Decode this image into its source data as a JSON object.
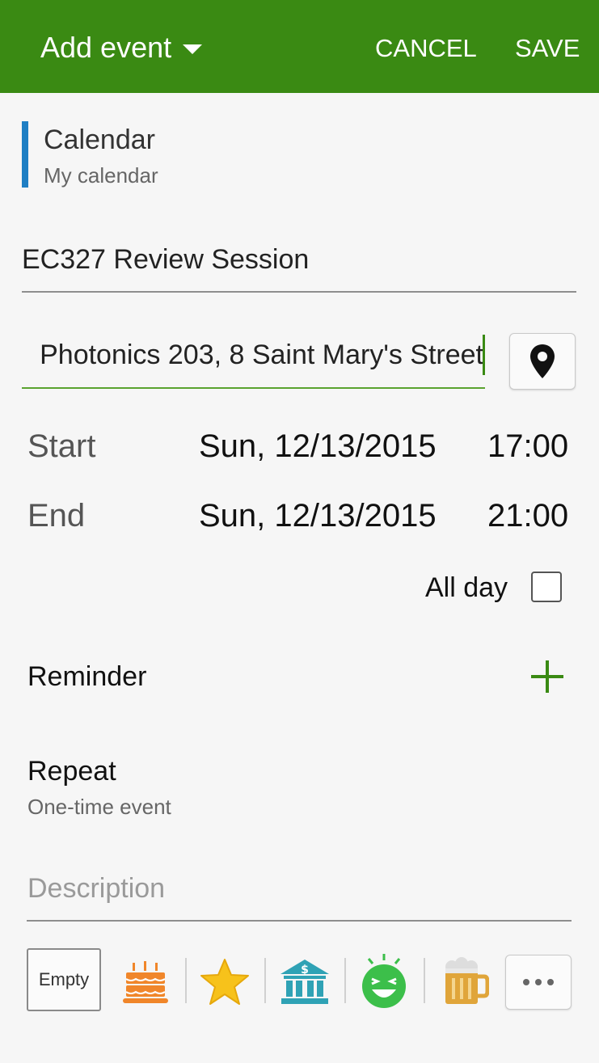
{
  "appbar": {
    "title": "Add event",
    "cancel_label": "CANCEL",
    "save_label": "SAVE",
    "color": "#3a8a13"
  },
  "calendar": {
    "label": "Calendar",
    "value": "My calendar",
    "accent_color": "#1f7fc4"
  },
  "event": {
    "title_value": "EC327 Review Session",
    "location_value": "Photonics 203, 8 Saint Mary's Street",
    "location_icon": "map-pin-icon"
  },
  "times": {
    "start_label": "Start",
    "start_date": "Sun, 12/13/2015",
    "start_time": "17:00",
    "end_label": "End",
    "end_date": "Sun, 12/13/2015",
    "end_time": "21:00",
    "all_day_label": "All day",
    "all_day_checked": false
  },
  "reminder": {
    "label": "Reminder",
    "add_icon": "plus-icon"
  },
  "repeat": {
    "label": "Repeat",
    "value": "One-time event"
  },
  "description": {
    "placeholder": "Description"
  },
  "stickers": {
    "empty_label": "Empty",
    "items": [
      "birthday-cake-icon",
      "star-icon",
      "bank-icon",
      "laughing-face-icon",
      "beer-mug-icon"
    ],
    "more_icon": "more-icon"
  }
}
